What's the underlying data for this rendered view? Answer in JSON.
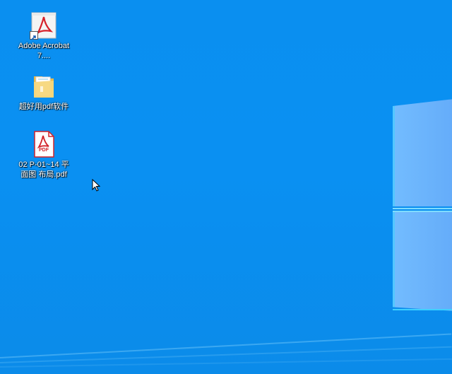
{
  "desktop": {
    "background_color": "#0a8ff0",
    "icons": [
      {
        "label": "Adobe Acrobat 7....",
        "icon": "acrobat-shortcut-icon"
      },
      {
        "label": "超好用pdf软件",
        "icon": "folder-icon"
      },
      {
        "label": "02 P-01~14 平面图 布局.pdf",
        "icon": "pdf-file-icon"
      }
    ]
  },
  "pdf_icon": {
    "badge_text": "PDF"
  }
}
